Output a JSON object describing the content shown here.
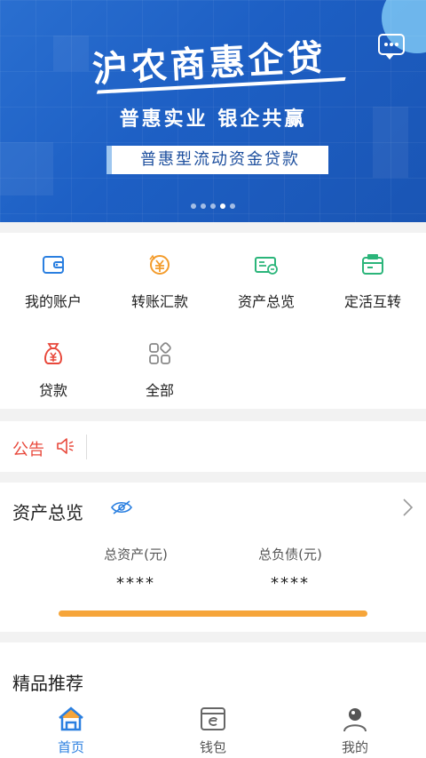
{
  "banner": {
    "title": "沪农商惠企贷",
    "subtitle": "普惠实业  银企共赢",
    "tag": "普惠型流动资金贷款",
    "indicators": 5,
    "active_indicator": 3
  },
  "menu": {
    "items": [
      {
        "label": "我的账户",
        "icon": "wallet-icon"
      },
      {
        "label": "转账汇款",
        "icon": "transfer-yuan-icon"
      },
      {
        "label": "资产总览",
        "icon": "assets-card-icon"
      },
      {
        "label": "定活互转",
        "icon": "fixed-current-icon"
      },
      {
        "label": "贷款",
        "icon": "loan-bag-icon"
      },
      {
        "label": "全部",
        "icon": "grid-all-icon"
      }
    ]
  },
  "notice": {
    "label": "公告",
    "icon": "speaker-icon"
  },
  "assets": {
    "title": "资产总览",
    "total_assets_label": "总资产(元)",
    "total_assets_value": "****",
    "total_debt_label": "总负债(元)",
    "total_debt_value": "****"
  },
  "recommend": {
    "title": "精品推荐"
  },
  "tabbar": {
    "tabs": [
      {
        "label": "首页",
        "icon": "home-icon",
        "active": true
      },
      {
        "label": "钱包",
        "icon": "wallet-e-icon",
        "active": false
      },
      {
        "label": "我的",
        "icon": "profile-icon",
        "active": false
      }
    ]
  },
  "colors": {
    "accent_blue": "#2a7fe0",
    "notice_red": "#e8483b",
    "bar_orange": "#f6a53a",
    "banner_blue": "#1d5fc4"
  }
}
